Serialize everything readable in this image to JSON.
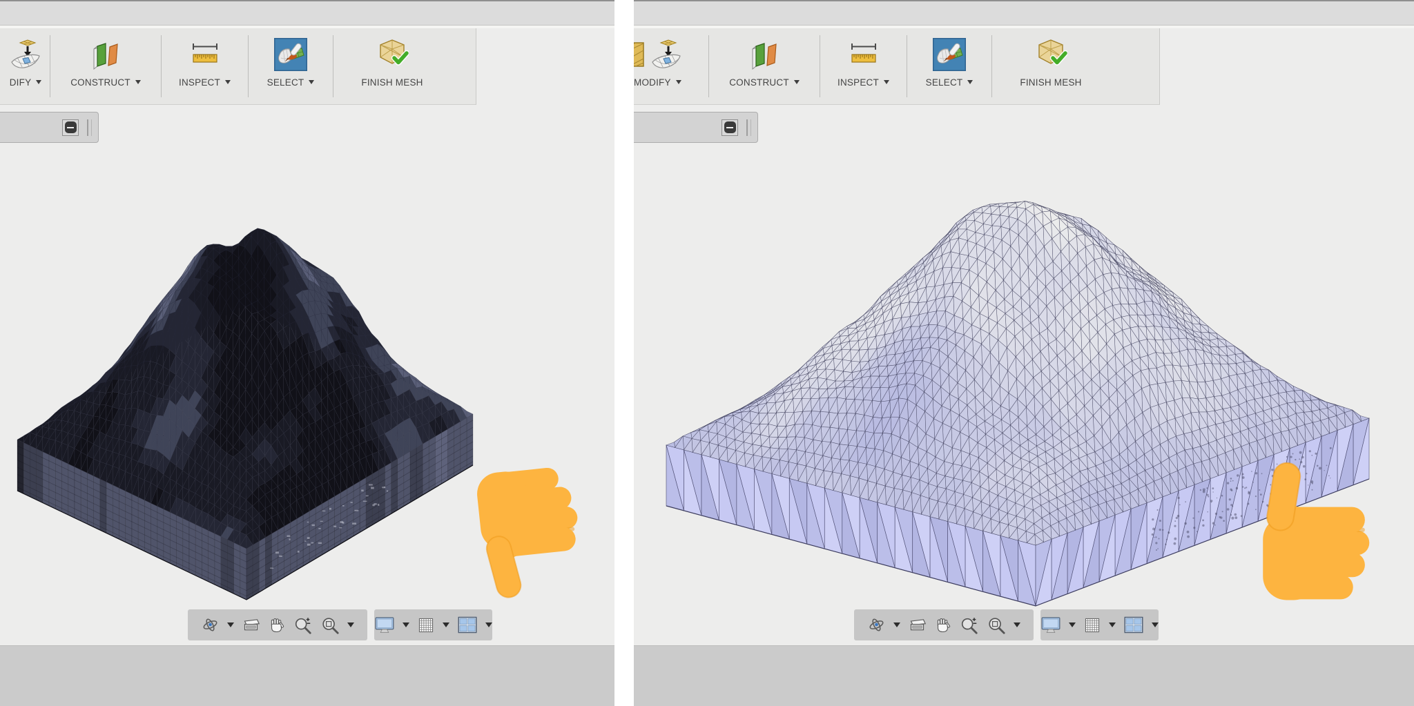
{
  "panels": [
    {
      "name": "before",
      "toolbar": {
        "groups": [
          {
            "label": "DIFY",
            "dropdown": true
          },
          {
            "label": "CONSTRUCT",
            "dropdown": true
          },
          {
            "label": "INSPECT",
            "dropdown": true
          },
          {
            "label": "SELECT",
            "dropdown": true,
            "active": true
          },
          {
            "label": "FINISH MESH",
            "dropdown": false
          }
        ]
      },
      "viewport": {
        "model": "dark textured terrain mesh block",
        "verdict_icon": "thumbs-down-emoji"
      }
    },
    {
      "name": "after",
      "toolbar": {
        "groups": [
          {
            "label": "MODIFY",
            "dropdown": true
          },
          {
            "label": "CONSTRUCT",
            "dropdown": true
          },
          {
            "label": "INSPECT",
            "dropdown": true
          },
          {
            "label": "SELECT",
            "dropdown": true,
            "active": true
          },
          {
            "label": "FINISH MESH",
            "dropdown": false
          }
        ]
      },
      "viewport": {
        "model": "lavender wireframe terrain mesh block",
        "verdict_icon": "thumbs-up-emoji"
      }
    }
  ],
  "nav_icons": [
    "orbit-icon",
    "look-at-icon",
    "pan-icon",
    "zoom-icon",
    "fit-icon",
    "display-settings-icon",
    "grid-settings-icon",
    "viewports-icon"
  ],
  "toolbar_icons": [
    "reduce-mesh-icon",
    "insert-mesh-icon",
    "construct-icon",
    "inspect-ruler-icon",
    "select-brush-icon",
    "finish-mesh-icon"
  ],
  "colors": {
    "titlebar": "#dcdcdc",
    "toolbar": "#e6e6e4",
    "viewport": "#ededec",
    "footer": "#cbcbcb",
    "navbar": "#c6c6c6",
    "select_active_blue": "#4383b4",
    "emoji": {
      "base": "#fdb440",
      "shade": "#ee9b1c"
    },
    "mesh_before": {
      "top_palette": [
        "#111118",
        "#191a24",
        "#242634",
        "#3f4458",
        "#5a5f78",
        "#787d92"
      ],
      "highlight": "#8d92a6",
      "wire": "#2c3042",
      "side_palette": [
        "#23242e",
        "#3c3f50",
        "#50546a",
        "#5e627b",
        "#6b6f86"
      ],
      "side_stroke": "#15151d",
      "bottom_edge": "#0d0d13",
      "glyph_marks": "#c9ccd8"
    },
    "mesh_after": {
      "top_low": "#b2b5e0",
      "top_high": "#f2f2ed",
      "wire": "#383854",
      "side_palette": [
        "#c7c9f3",
        "#bbbee9",
        "#ced0f6",
        "#b3b6e3"
      ],
      "side_stroke": "#4a4a70",
      "bottom_edge": "#3c3c5e",
      "emboss": "#3e3e58"
    }
  }
}
